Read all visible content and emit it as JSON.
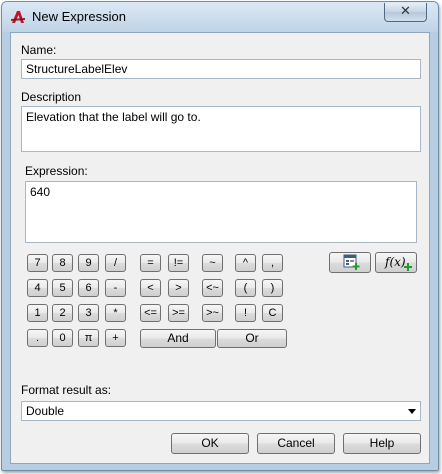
{
  "window": {
    "title": "New Expression",
    "close_glyph": "✕",
    "app_icon": "autocad-civil-icon"
  },
  "name_field": {
    "label": "Name:",
    "value": "StructureLabelElev"
  },
  "description_field": {
    "label": "Description",
    "value": "Elevation that the label will go to."
  },
  "expression_field": {
    "label": "Expression:",
    "value": "640"
  },
  "keypad": {
    "numbers": {
      "row1": [
        "7",
        "8",
        "9",
        "/"
      ],
      "row2": [
        "4",
        "5",
        "6",
        "-"
      ],
      "row3": [
        "1",
        "2",
        "3",
        "*"
      ],
      "row4": [
        ".",
        "0",
        "π",
        "+"
      ]
    },
    "comparisons": {
      "row1": [
        "=",
        "!=",
        "~"
      ],
      "row2": [
        "<",
        ">",
        "<~"
      ],
      "row3": [
        "<=",
        ">=",
        ">~"
      ]
    },
    "operators": {
      "row1": [
        "^",
        ","
      ],
      "row2": [
        "(",
        ")"
      ],
      "row3": [
        "!",
        "C"
      ]
    },
    "and_label": "And",
    "or_label": "Or",
    "insert_property_icon": "insert-property-icon",
    "insert_function_icon": "insert-function-icon",
    "insert_function_glyph": "f(x)"
  },
  "format": {
    "label": "Format result as:",
    "value": "Double"
  },
  "buttons": {
    "ok": "OK",
    "cancel": "Cancel",
    "help": "Help"
  }
}
